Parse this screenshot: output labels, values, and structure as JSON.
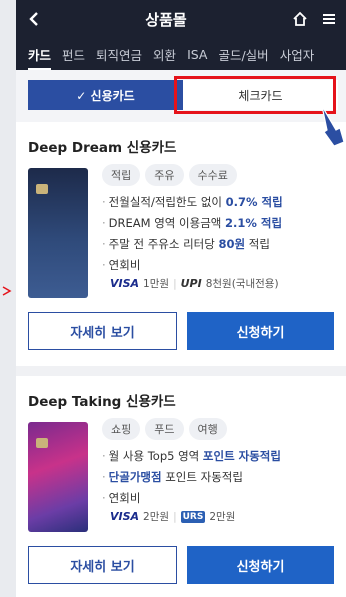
{
  "header": {
    "title": "상품몰",
    "back_icon": "back-icon",
    "home_icon": "home-icon",
    "menu_icon": "menu-icon"
  },
  "catnav": {
    "items": [
      "카드",
      "펀드",
      "퇴직연금",
      "외환",
      "ISA",
      "골드/실버",
      "사업자"
    ]
  },
  "subtabs": {
    "credit": "✓ 신용카드",
    "check": "체크카드"
  },
  "cards": [
    {
      "name": "Deep Dream 신용카드",
      "tags": [
        "적립",
        "주유",
        "수수료"
      ],
      "bullets": [
        {
          "pre": "전월실적/적립한도 없이 ",
          "hl": "0.7% 적립",
          "post": ""
        },
        {
          "pre": "DREAM 영역 이용금액 ",
          "hl": "2.1% 적립",
          "post": ""
        },
        {
          "pre": "주말 전 주유소 리터당 ",
          "hl": "80원",
          "post": " 적립"
        }
      ],
      "fee_label": "연회비",
      "fee": {
        "brand1": "VISA",
        "amount1": "1만원",
        "brand2": "UPI",
        "amount2": "8천원(국내전용)"
      },
      "detail_btn": "자세히 보기",
      "apply_btn": "신청하기"
    },
    {
      "name": "Deep Taking 신용카드",
      "tags": [
        "쇼핑",
        "푸드",
        "여행"
      ],
      "bullets": [
        {
          "pre": "월 사용 Top5 영역 ",
          "hl": "포인트 자동적립",
          "post": ""
        },
        {
          "pre": "",
          "hl": "단골가맹점",
          "post": " 포인트 자동적립"
        }
      ],
      "fee_label": "연회비",
      "fee": {
        "brand1": "VISA",
        "amount1": "2만원",
        "brand2": "URS",
        "amount2": "2만원"
      },
      "detail_btn": "자세히 보기",
      "apply_btn": "신청하기"
    }
  ],
  "colors": {
    "header_bg": "#1c2130",
    "accent": "#2b4ea2",
    "apply_btn": "#1f63c6",
    "highlight_box": "#e5121a"
  }
}
